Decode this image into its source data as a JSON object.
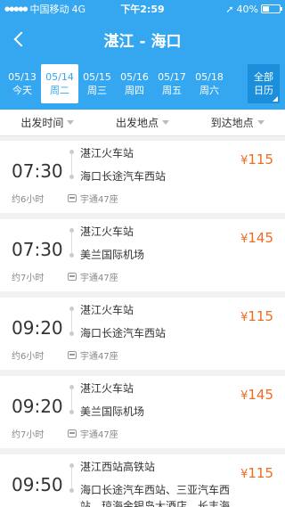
{
  "status": {
    "carrier": "中国移动",
    "network": "4G",
    "time": "下午2:59",
    "battery": "40%",
    "battery_level": 0.4
  },
  "header": {
    "title": "湛江 - 海口",
    "back_icon": "chevron-left-icon"
  },
  "dates": [
    {
      "date": "05/13",
      "weekday": "今天"
    },
    {
      "date": "05/14",
      "weekday": "周二"
    },
    {
      "date": "05/15",
      "weekday": "周三"
    },
    {
      "date": "05/16",
      "weekday": "周四"
    },
    {
      "date": "05/17",
      "weekday": "周五"
    },
    {
      "date": "05/18",
      "weekday": "周六"
    }
  ],
  "calendar": {
    "line1": "全部",
    "line2": "日历"
  },
  "filters": {
    "departure_time": "出发时间",
    "departure_place": "出发地点",
    "arrival_place": "到达地点"
  },
  "trips": [
    {
      "time": "07:30",
      "duration": "约6小时",
      "from": "湛江火车站",
      "to": "海口长途汽车西站",
      "bus": "宇通47座",
      "currency": "¥",
      "price": "115"
    },
    {
      "time": "07:30",
      "duration": "约7小时",
      "from": "湛江火车站",
      "to": "美兰国际机场",
      "bus": "宇通47座",
      "currency": "¥",
      "price": "145"
    },
    {
      "time": "09:20",
      "duration": "约6小时",
      "from": "湛江火车站",
      "to": "海口长途汽车西站",
      "bus": "宇通47座",
      "currency": "¥",
      "price": "115"
    },
    {
      "time": "09:20",
      "duration": "约7小时",
      "from": "湛江火车站",
      "to": "美兰国际机场",
      "bus": "宇通47座",
      "currency": "¥",
      "price": "145"
    },
    {
      "time": "09:50",
      "from": "湛江西站高铁站",
      "to": "海口长途汽车西站、三亚汽车西",
      "to_line2": "站、琼海金银岛大酒店、长丰海",
      "currency": "¥",
      "price": "115"
    }
  ],
  "colors": {
    "brand": "#35a7f0",
    "price": "#f26b1d"
  }
}
